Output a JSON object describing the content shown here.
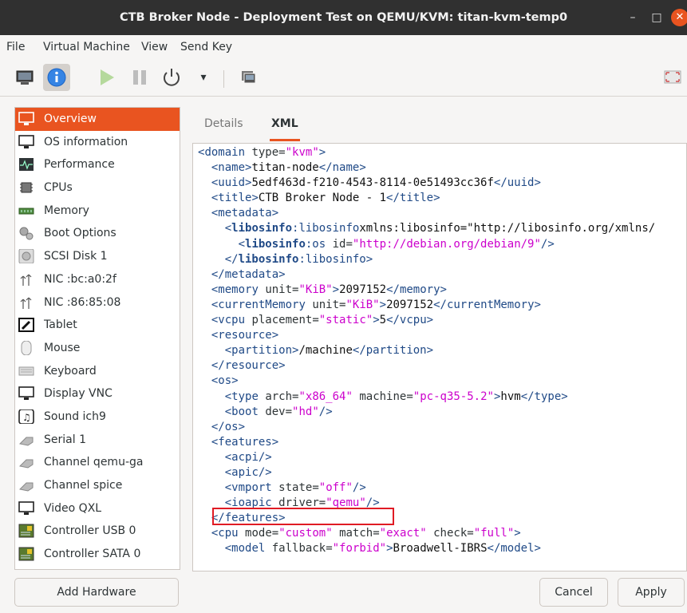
{
  "window": {
    "title": "CTB Broker Node - Deployment Test on QEMU/KVM: titan-kvm-temp0",
    "minimize": "–",
    "maximize": "□",
    "close": "✕"
  },
  "menubar": [
    "File",
    "Virtual Machine",
    "View",
    "Send Key"
  ],
  "toolbar": {
    "icons": [
      "monitor-icon",
      "info-icon",
      "play-icon",
      "pause-icon",
      "power-icon",
      "dropdown-chevron-icon",
      "snapshot-icon",
      "fullscreen-icon"
    ],
    "dropdown": "▾"
  },
  "sidebar": {
    "items": [
      {
        "label": "Overview",
        "icon": "overview-icon",
        "selected": true
      },
      {
        "label": "OS information",
        "icon": "monitor-icon"
      },
      {
        "label": "Performance",
        "icon": "performance-icon"
      },
      {
        "label": "CPUs",
        "icon": "cpu-icon"
      },
      {
        "label": "Memory",
        "icon": "memory-icon"
      },
      {
        "label": "Boot Options",
        "icon": "boot-gear-icon"
      },
      {
        "label": "SCSI Disk 1",
        "icon": "disk-icon"
      },
      {
        "label": "NIC :bc:a0:2f",
        "icon": "nic-icon"
      },
      {
        "label": "NIC :86:85:08",
        "icon": "nic-icon"
      },
      {
        "label": "Tablet",
        "icon": "tablet-icon"
      },
      {
        "label": "Mouse",
        "icon": "mouse-icon"
      },
      {
        "label": "Keyboard",
        "icon": "keyboard-icon"
      },
      {
        "label": "Display VNC",
        "icon": "display-icon"
      },
      {
        "label": "Sound ich9",
        "icon": "sound-icon"
      },
      {
        "label": "Serial 1",
        "icon": "serial-icon"
      },
      {
        "label": "Channel qemu-ga",
        "icon": "channel-icon"
      },
      {
        "label": "Channel spice",
        "icon": "channel-icon"
      },
      {
        "label": "Video QXL",
        "icon": "video-icon"
      },
      {
        "label": "Controller USB 0",
        "icon": "controller-icon"
      },
      {
        "label": "Controller SATA 0",
        "icon": "controller-icon"
      }
    ]
  },
  "tabs": {
    "details": "Details",
    "xml": "XML"
  },
  "xml_lines": [
    "<domain type=\"kvm\">",
    "  <name>titan-node</name>",
    "  <uuid>5edf463d-f210-4543-8114-0e51493cc36f</uuid>",
    "  <title>CTB Broker Node - 1</title>",
    "  <metadata>",
    "    <libosinfo:libosinfo xmlns:libosinfo=\"http://libosinfo.org/xmlns/",
    "      <libosinfo:os id=\"http://debian.org/debian/9\"/>",
    "    </libosinfo:libosinfo>",
    "  </metadata>",
    "  <memory unit=\"KiB\">2097152</memory>",
    "  <currentMemory unit=\"KiB\">2097152</currentMemory>",
    "  <vcpu placement=\"static\">5</vcpu>",
    "  <resource>",
    "    <partition>/machine</partition>",
    "  </resource>",
    "  <os>",
    "    <type arch=\"x86_64\" machine=\"pc-q35-5.2\">hvm</type>",
    "    <boot dev=\"hd\"/>",
    "  </os>",
    "  <features>",
    "    <acpi/>",
    "    <apic/>",
    "    <vmport state=\"off\"/>",
    "    <ioapic driver=\"qemu\"/>",
    "  </features>",
    "  <cpu mode=\"custom\" match=\"exact\" check=\"full\">",
    "    <model fallback=\"forbid\">Broadwell-IBRS</model>"
  ],
  "highlighted_line": "    <ioapic driver=\"qemu\"/>",
  "buttons": {
    "add_hardware": "Add Hardware",
    "cancel": "Cancel",
    "apply": "Apply"
  },
  "colors": {
    "accent": "#e95420",
    "tag": "#204a87",
    "string": "#cc00cc",
    "highlight_box": "#e01b24"
  }
}
